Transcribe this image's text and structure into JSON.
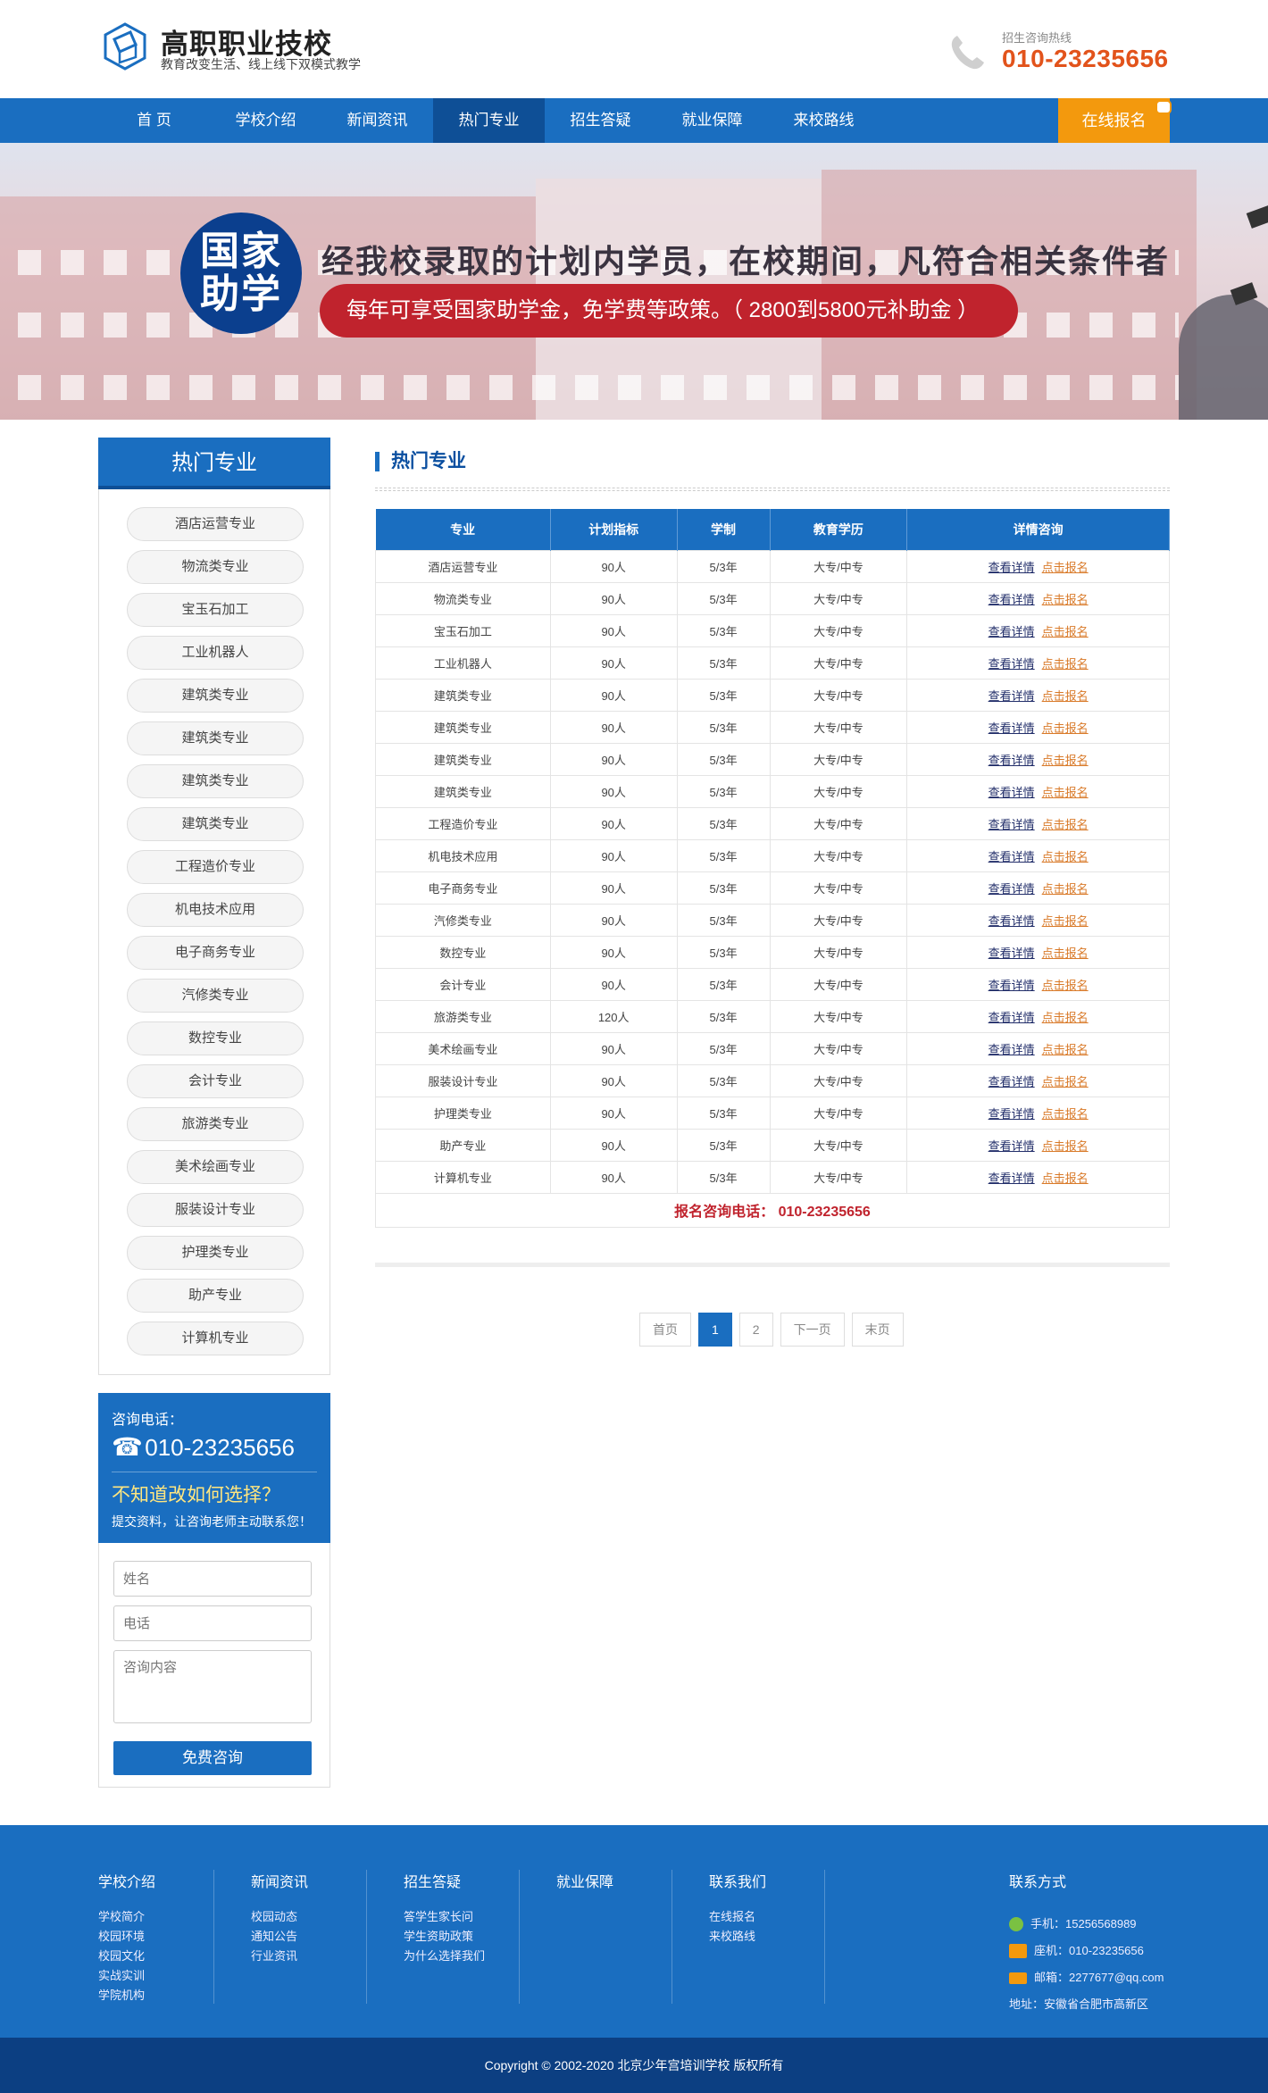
{
  "header": {
    "title": "高职职业技校",
    "subtitle": "教育改变生活、线上线下双模式教学",
    "hotline_label": "招生咨询热线",
    "hotline_number": "010-23235656"
  },
  "nav": {
    "items": [
      "首 页",
      "学校介绍",
      "新闻资讯",
      "热门专业",
      "招生答疑",
      "就业保障",
      "来校路线"
    ],
    "active": "热门专业",
    "apply_label": "在线报名"
  },
  "banner": {
    "badge": "国家助学",
    "badge_line1": "国家",
    "badge_line2": "助学",
    "headline": "经我校录取的计划内学员，在校期间，凡符合相关条件者",
    "pill_text": "每年可享受国家助学金，免学费等政策。（ 2800到5800元补助金 ）"
  },
  "sidebar": {
    "title": "热门专业",
    "items": [
      "酒店运营专业",
      "物流类专业",
      "宝玉石加工",
      "工业机器人",
      "建筑类专业",
      "建筑类专业",
      "建筑类专业",
      "建筑类专业",
      "工程造价专业",
      "机电技术应用",
      "电子商务专业",
      "汽修类专业",
      "数控专业",
      "会计专业",
      "旅游类专业",
      "美术绘画专业",
      "服装设计专业",
      "护理类专业",
      "助产专业",
      "计算机专业"
    ],
    "contact": {
      "label": "咨询电话：",
      "phone": "010-23235656",
      "question": "不知道改如何选择？",
      "note": "提交资料，让咨询老师主动联系您！"
    },
    "form": {
      "name_placeholder": "姓名",
      "phone_placeholder": "电话",
      "content_placeholder": "咨询内容",
      "submit_label": "免费咨询"
    }
  },
  "main": {
    "title": "热门专业",
    "table": {
      "headers": [
        "专业",
        "计划指标",
        "学制",
        "教育学历",
        "详情咨询"
      ],
      "rows": [
        [
          "酒店运营专业",
          "90人",
          "5/3年",
          "大专/中专"
        ],
        [
          "物流类专业",
          "90人",
          "5/3年",
          "大专/中专"
        ],
        [
          "宝玉石加工",
          "90人",
          "5/3年",
          "大专/中专"
        ],
        [
          "工业机器人",
          "90人",
          "5/3年",
          "大专/中专"
        ],
        [
          "建筑类专业",
          "90人",
          "5/3年",
          "大专/中专"
        ],
        [
          "建筑类专业",
          "90人",
          "5/3年",
          "大专/中专"
        ],
        [
          "建筑类专业",
          "90人",
          "5/3年",
          "大专/中专"
        ],
        [
          "建筑类专业",
          "90人",
          "5/3年",
          "大专/中专"
        ],
        [
          "工程造价专业",
          "90人",
          "5/3年",
          "大专/中专"
        ],
        [
          "机电技术应用",
          "90人",
          "5/3年",
          "大专/中专"
        ],
        [
          "电子商务专业",
          "90人",
          "5/3年",
          "大专/中专"
        ],
        [
          "汽修类专业",
          "90人",
          "5/3年",
          "大专/中专"
        ],
        [
          "数控专业",
          "90人",
          "5/3年",
          "大专/中专"
        ],
        [
          "会计专业",
          "90人",
          "5/3年",
          "大专/中专"
        ],
        [
          "旅游类专业",
          "120人",
          "5/3年",
          "大专/中专"
        ],
        [
          "美术绘画专业",
          "90人",
          "5/3年",
          "大专/中专"
        ],
        [
          "服装设计专业",
          "90人",
          "5/3年",
          "大专/中专"
        ],
        [
          "护理类专业",
          "90人",
          "5/3年",
          "大专/中专"
        ],
        [
          "助产专业",
          "90人",
          "5/3年",
          "大专/中专"
        ],
        [
          "计算机专业",
          "90人",
          "5/3年",
          "大专/中专"
        ]
      ],
      "detail_link": "查看详情",
      "apply_link": "点击报名",
      "footer": "报名咨询电话： 010-23235656"
    },
    "pager": [
      "首页",
      "1",
      "2",
      "下一页",
      "末页"
    ],
    "pager_active": "1"
  },
  "footer": {
    "columns": [
      {
        "title": "学校介绍",
        "links": [
          "学校简介",
          "校园环境",
          "校园文化",
          "实战实训",
          "学院机构"
        ]
      },
      {
        "title": "新闻资讯",
        "links": [
          "校园动态",
          "通知公告",
          "行业资讯"
        ]
      },
      {
        "title": "招生答疑",
        "links": [
          "答学生家长问",
          "学生资助政策",
          "为什么选择我们"
        ]
      },
      {
        "title": "就业保障",
        "links": []
      },
      {
        "title": "联系我们",
        "links": [
          "在线报名",
          "来校路线"
        ]
      }
    ],
    "contact_title": "联系方式",
    "mobile": "手机：15256568989",
    "landline": "座机：010-23235656",
    "email": "邮箱：2277677@qq.com",
    "address": "地址：安徽省合肥市高新区",
    "copyright": "Copyright © 2002-2020 北京少年宫培训学校 版权所有"
  },
  "colors": {
    "primary": "#1a6ec0",
    "primary_dark": "#0e4f96",
    "accent_orange": "#f3990d",
    "hotline_orange": "#e2531b",
    "banner_red": "#c0232d"
  }
}
